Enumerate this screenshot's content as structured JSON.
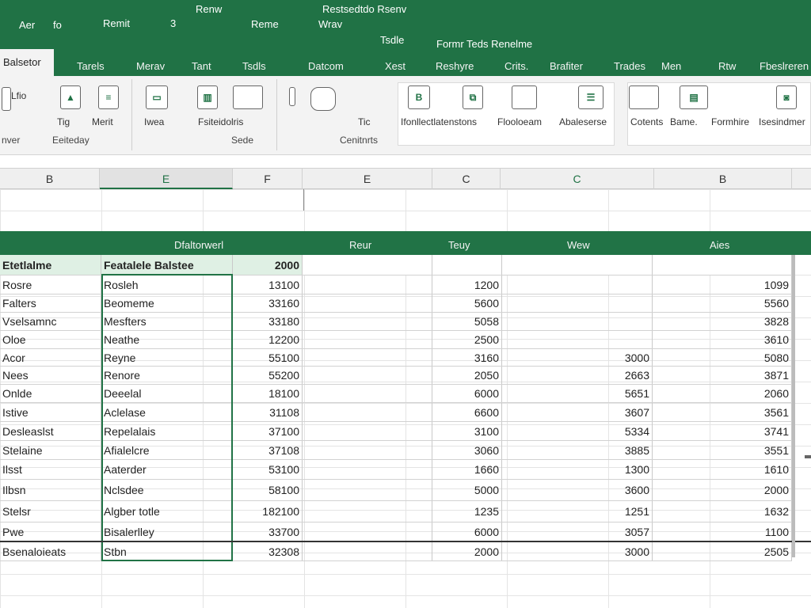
{
  "title": {
    "row1": [
      "Renw",
      "Restsedtdo Rsenv"
    ],
    "row2": [
      "Aer",
      "fo",
      "Remit",
      "3",
      "Reme",
      "Wrav"
    ],
    "row3": [
      "Tsdle",
      "Formr Teds Renelme"
    ]
  },
  "tabs": {
    "active": "Balsetor",
    "items": [
      "Tarels",
      "Merav",
      "Tant",
      "Tsdls",
      "Datcom",
      "Xest",
      "Reshyre",
      "Crits.",
      "Brafiter",
      "Trades",
      "Men",
      "Rtw",
      "Fbeslreren"
    ]
  },
  "ribbon": {
    "labels": [
      "Lfio",
      "Tig",
      "Merit",
      "Iwea",
      "Fsiteidolris",
      "Tic",
      "Ifonllectlatenstons",
      "Flooloeam",
      "Abaleserse",
      "Cotents",
      "Bame.",
      "Formhire",
      "Isesindmer"
    ],
    "groups": [
      "Eeiteday",
      "Sede",
      "Cenitnrts",
      "nver"
    ]
  },
  "column_headers": [
    "B",
    "E",
    "F",
    "E",
    "C",
    "C",
    "B"
  ],
  "table": {
    "band_headers": [
      "Dfaltorwerl",
      "Reur",
      "Teuy",
      "Wew",
      "Aies"
    ],
    "header_row": [
      "Etetlalme",
      "Featalele Balstee",
      "2000",
      "",
      "",
      "",
      ""
    ],
    "rows": [
      [
        "Rosre",
        "Rosleh",
        "13100",
        "",
        "1200",
        "",
        "1099"
      ],
      [
        "Falters",
        "Beomeme",
        "33160",
        "",
        "5600",
        "",
        "5560"
      ],
      [
        "Vselsamnc",
        "Mesfters",
        "33180",
        "",
        "5058",
        "",
        "3828"
      ],
      [
        "Oloe",
        "Neathe",
        "12200",
        "",
        "2500",
        "",
        "3610"
      ],
      [
        "Acor",
        "Reyne",
        "55100",
        "",
        "3160",
        "3000",
        "5080"
      ],
      [
        "Nees",
        "Renore",
        "55200",
        "",
        "2050",
        "2663",
        "3871"
      ],
      [
        "Onlde",
        "Deeelal",
        "18100",
        "",
        "6000",
        "5651",
        "2060"
      ],
      [
        "Istive",
        "Aclelase",
        "31108",
        "",
        "6600",
        "3607",
        "3561"
      ],
      [
        "Desleaslst",
        "Repelalais",
        "37100",
        "",
        "3100",
        "5334",
        "3741"
      ],
      [
        "Stelaine",
        "Afialelcre",
        "37108",
        "",
        "3060",
        "3885",
        "3551"
      ],
      [
        "Ilsst",
        "Aaterder",
        "53100",
        "",
        "1660",
        "1300",
        "1610"
      ],
      [
        "Ilbsn",
        "Nclsdee",
        "58100",
        "",
        "5000",
        "3600",
        "2000"
      ],
      [
        "Stelsr",
        "Algber totle",
        "182100",
        "",
        "1235",
        "1251",
        "1632"
      ],
      [
        "Pwe",
        "Bisalerlley",
        "33700",
        "",
        "6000",
        "3057",
        "1100"
      ],
      [
        "Bsenaloieats",
        "Stbn",
        "32308",
        "",
        "2000",
        "3000",
        "2505"
      ]
    ]
  },
  "colors": {
    "accent": "#217346",
    "header_fill": "#dff0e4"
  }
}
